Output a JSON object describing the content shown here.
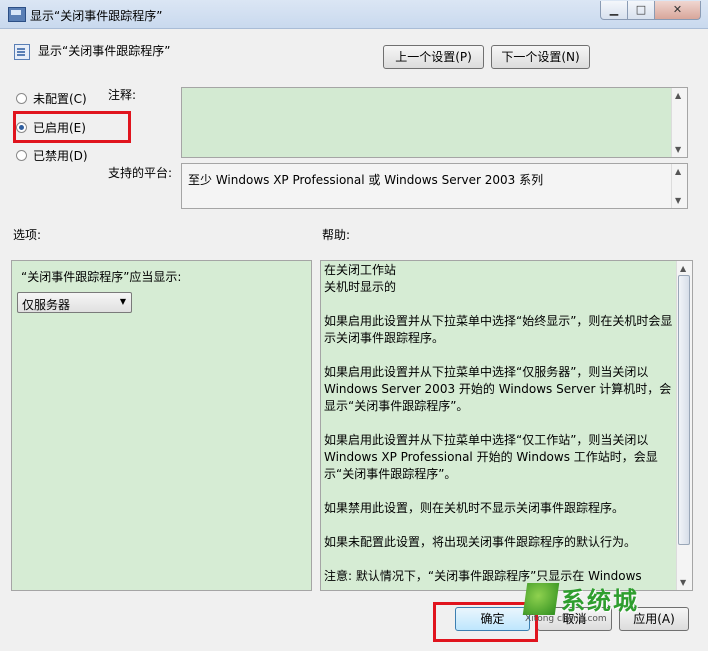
{
  "window": {
    "title": "显示“关闭事件跟踪程序”",
    "controls": {
      "minimize": "▁",
      "maximize": "□",
      "close": "✕"
    }
  },
  "header": {
    "policy_name": "显示“关闭事件跟踪程序”",
    "prev_button": "上一个设置(P)",
    "next_button": "下一个设置(N)"
  },
  "state": {
    "options": [
      {
        "label": "未配置(C)",
        "checked": false
      },
      {
        "label": "已启用(E)",
        "checked": true
      },
      {
        "label": "已禁用(D)",
        "checked": false
      }
    ]
  },
  "comment": {
    "label": "注释:",
    "value": ""
  },
  "platform": {
    "label": "支持的平台:",
    "value": "至少 Windows XP Professional 或 Windows Server 2003 系列"
  },
  "options_panel": {
    "section_label": "选项:",
    "field_label": "“关闭事件跟踪程序”应当显示:",
    "selected": "仅服务器"
  },
  "help_panel": {
    "section_label": "帮助:",
    "paragraphs": [
      "在关闭工作站",
      "关机时显示的",
      "如果启用此设置并从下拉菜单中选择“始终显示”，则在关机时会显示关闭事件跟踪程序。",
      "如果启用此设置并从下拉菜单中选择“仅服务器”，则当关闭以 Windows Server 2003 开始的 Windows Server 计算机时，会显示“关闭事件跟踪程序”。",
      "如果启用此设置并从下拉菜单中选择“仅工作站”，则当关闭以 Windows XP Professional 开始的 Windows 工作站时，会显示“关闭事件跟踪程序”。",
      "如果禁用此设置，则在关机时不显示关闭事件跟踪程序。",
      "如果未配置此设置，将出现关闭事件跟踪程序的默认行为。",
      "注意: 默认情况下，“关闭事件跟踪程序”只显示在 Windows"
    ]
  },
  "footer": {
    "ok_button": "确定",
    "cancel_button": "取消",
    "apply_button": "应用(A)"
  },
  "watermark": {
    "text": "系统城",
    "url": "Xitong cheng.com"
  }
}
